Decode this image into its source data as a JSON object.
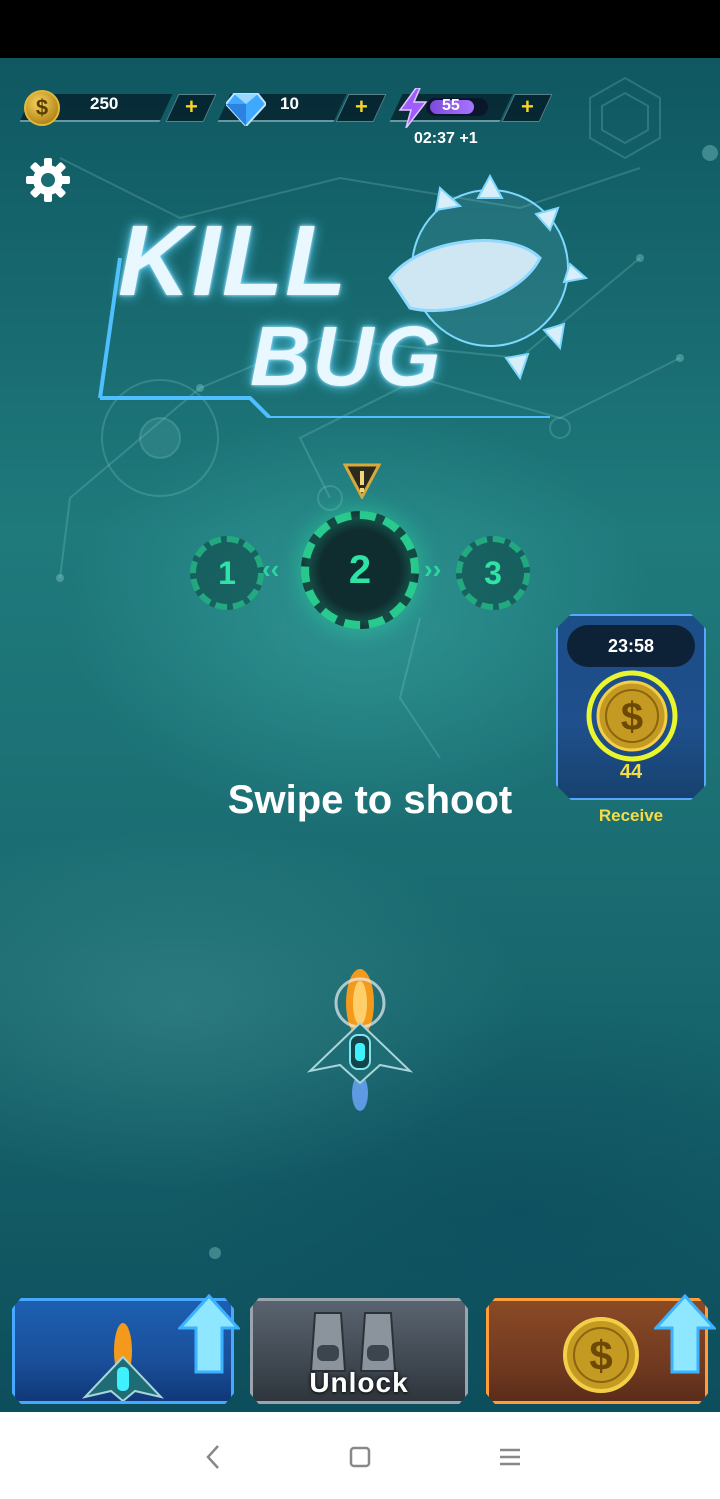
{
  "currencies": {
    "coins": "250",
    "gems": "10",
    "energy": "55",
    "energy_timer": "02:37 +1",
    "plus": "+"
  },
  "stages": {
    "items": [
      "1",
      "2",
      "3"
    ],
    "current": "2"
  },
  "reward": {
    "timer": "23:58",
    "amount": "44",
    "receive_label": "Receive"
  },
  "hint": "Swipe to shoot",
  "bottom_buttons": {
    "unlock_label": "Unlock"
  },
  "logo": {
    "line1": "KILL",
    "line2": "BUG"
  },
  "icons": {
    "coin": "coin-icon",
    "gem": "gem-icon",
    "energy": "lightning-icon",
    "settings": "gear-icon",
    "warning": "warning-icon",
    "up_arrow": "arrow-up-icon"
  },
  "colors": {
    "accent_green": "#2fe3a6",
    "gold": "#f4dc49",
    "blue_button": "#1d5fb1",
    "orange_button": "#8a4a26"
  }
}
